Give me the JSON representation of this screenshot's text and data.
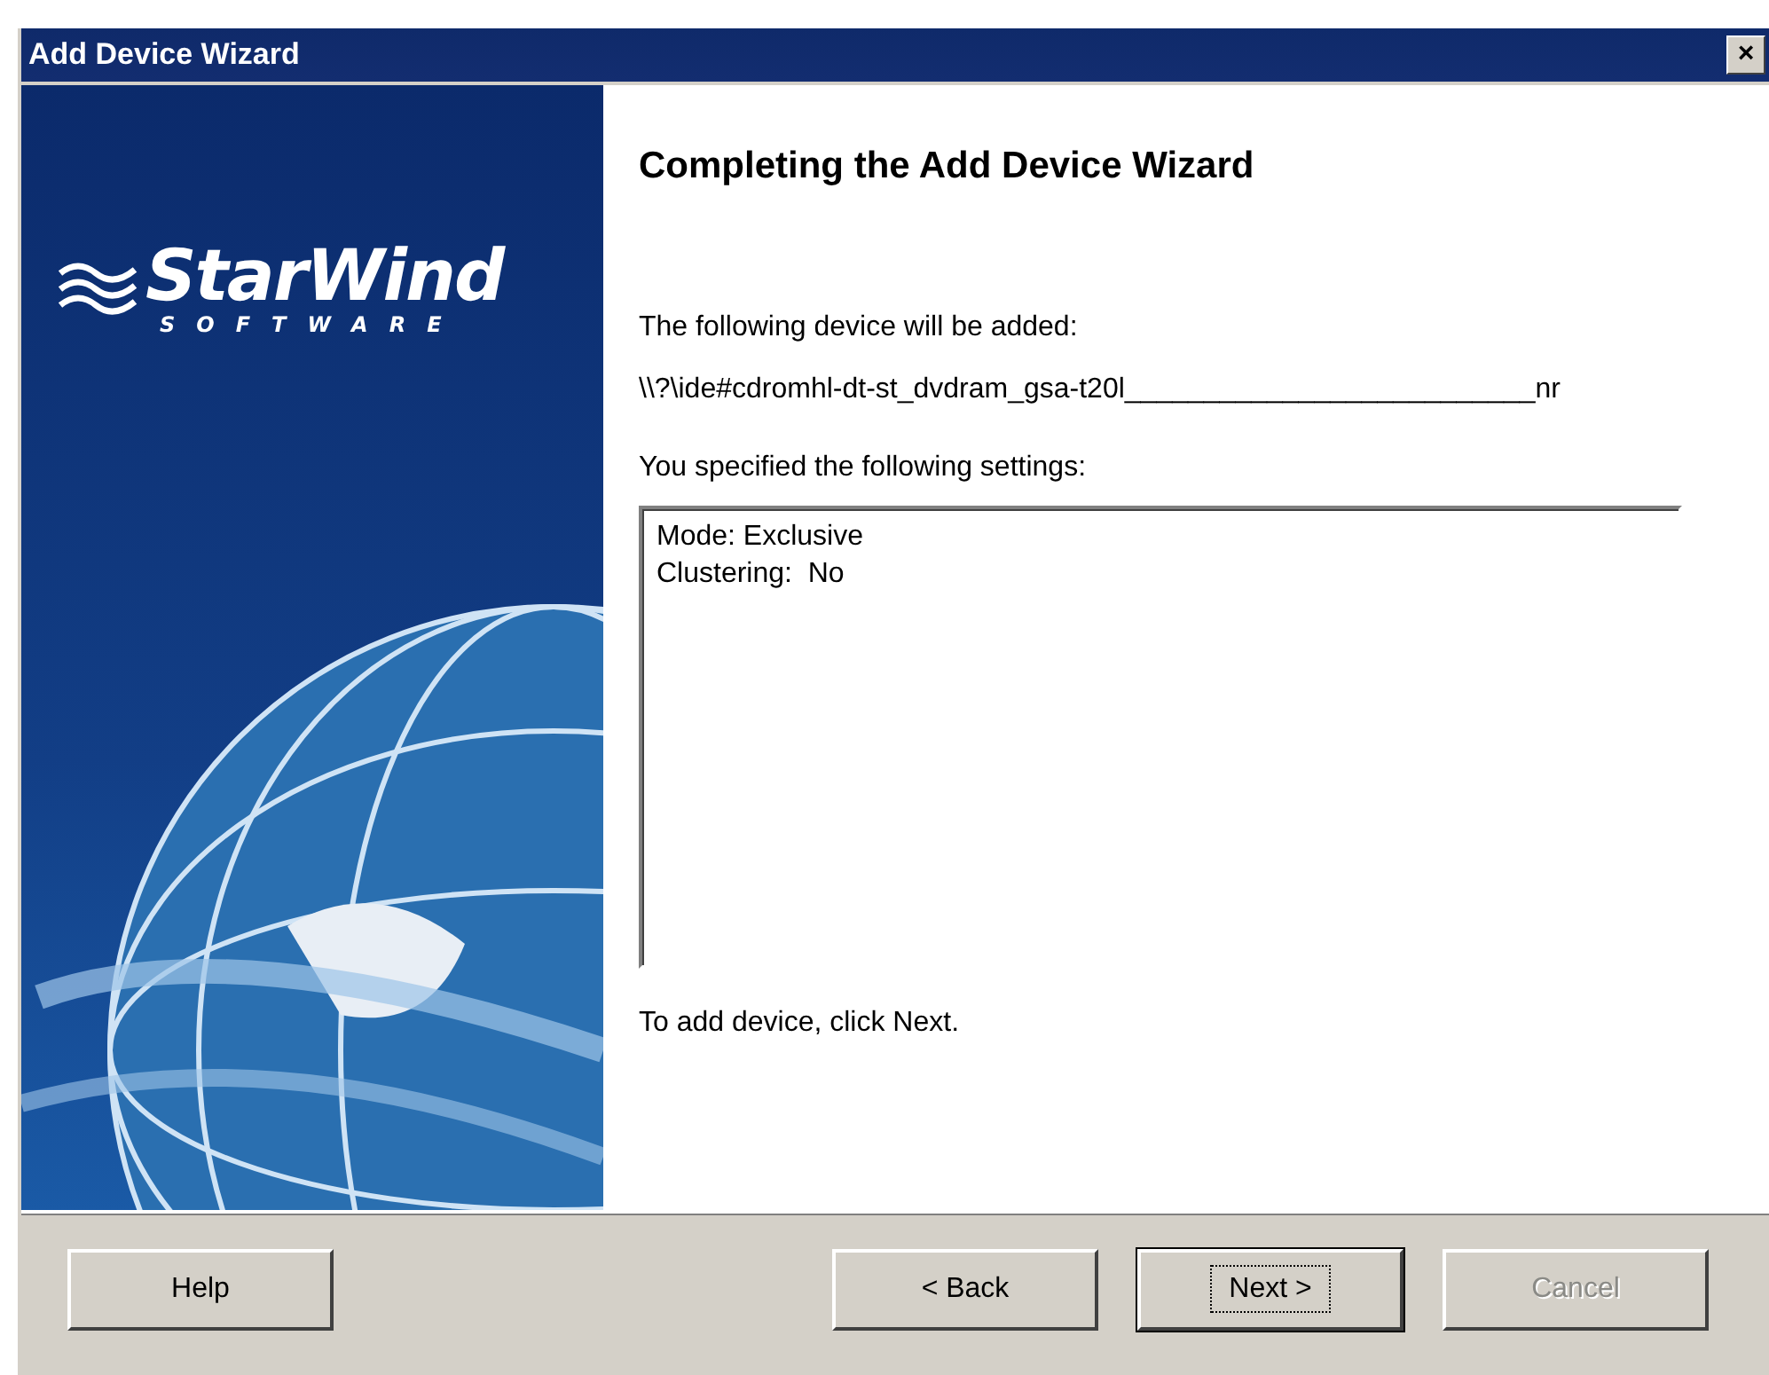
{
  "window": {
    "title": "Add Device Wizard",
    "close": "×"
  },
  "logo": {
    "name": "StarWind",
    "subtitle": "SOFTWARE"
  },
  "heading": "Completing the Add Device Wizard",
  "device_label": "The following device will be added:",
  "device_path": "\\\\?\\ide#cdromhl-dt-st_dvdram_gsa-t20l__________________________nr",
  "settings_label": "You specified the following settings:",
  "settings": [
    "Mode: Exclusive",
    "Clustering:  No"
  ],
  "hint": "To add device, click Next.",
  "buttons": [
    {
      "label": "Help",
      "kind": "help",
      "default": false,
      "disabled": false
    },
    {
      "label": "< Back",
      "kind": "nav",
      "default": false,
      "disabled": false
    },
    {
      "label": "Next >",
      "kind": "nav",
      "default": true,
      "disabled": false
    },
    {
      "label": "Cancel",
      "kind": "nav",
      "default": false,
      "disabled": true
    }
  ]
}
